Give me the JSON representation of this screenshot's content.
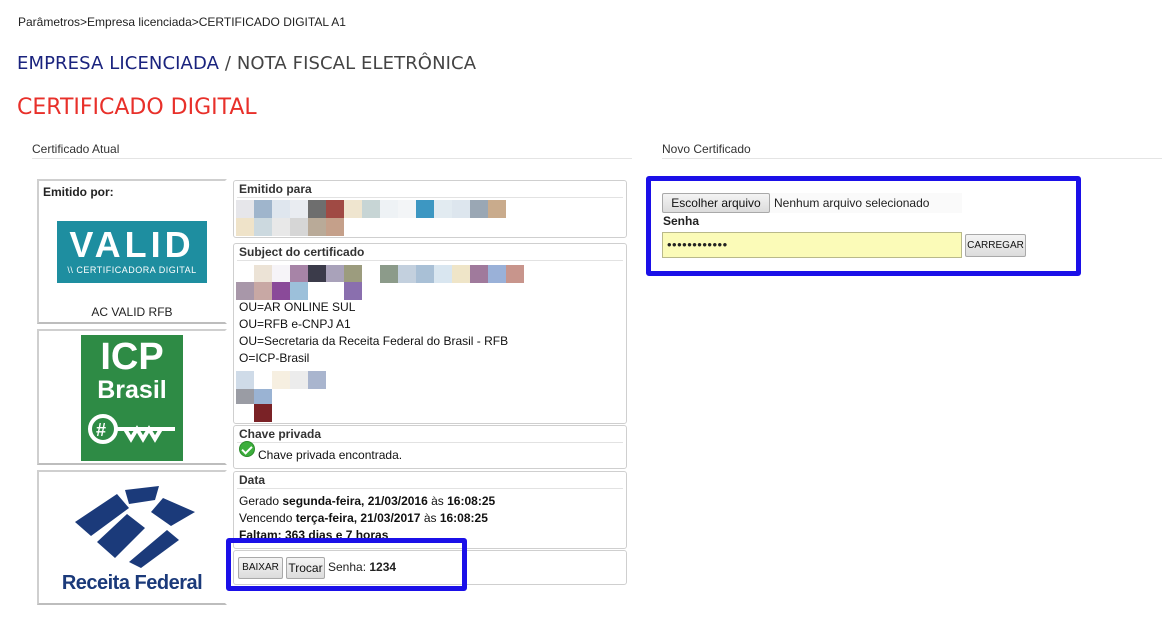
{
  "breadcrumb": "Parâmetros>Empresa licenciada>CERTIFICADO DIGITAL A1",
  "heading": {
    "part1": "EMPRESA LICENCIADA",
    "separator": " / ",
    "part2": "NOTA FISCAL ELETRÔNICA"
  },
  "page_title": "CERTIFICADO DIGITAL",
  "current_cert": {
    "section_label": "Certificado Atual",
    "issuer_label": "Emitido por:",
    "issuer_logo": {
      "main": "VALID",
      "sub": "\\\\ CERTIFICADORA DIGITAL"
    },
    "issuer_name": "AC VALID RFB",
    "icp_logo": {
      "line1": "ICP",
      "line2": "Brasil"
    },
    "rf_logo_text": "Receita Federal",
    "issued_to": {
      "title": "Emitido para"
    },
    "subject": {
      "title": "Subject do certificado",
      "lines": [
        "OU=AR ONLINE SUL",
        "OU=RFB e-CNPJ A1",
        "OU=Secretaria da Receita Federal do Brasil - RFB",
        "O=ICP-Brasil"
      ]
    },
    "private_key": {
      "title": "Chave privada",
      "status": "Chave privada encontrada."
    },
    "dates": {
      "title": "Data",
      "generated_prefix": "Gerado ",
      "generated_date": "segunda-feira, 21/03/2016",
      "generated_at": " às ",
      "generated_time": "16:08:25",
      "expires_prefix": "Vencendo ",
      "expires_date": "terça-feira, 21/03/2017",
      "expires_at": " às ",
      "expires_time": "16:08:25",
      "remaining": "Faltam: 363 dias e 7 horas"
    },
    "actions": {
      "download_label": "BAIXAR",
      "change_label": "Trocar",
      "password_label": "Senha: ",
      "password_value": "1234"
    }
  },
  "new_cert": {
    "section_label": "Novo Certificado",
    "choose_file_label": "Escolher arquivo",
    "no_file_text": "Nenhum arquivo selecionado",
    "password_label": "Senha",
    "password_value": "••••••••••••",
    "load_label": "CARREGAR"
  },
  "colors": {
    "title_red": "#e8302a",
    "heading_navy": "#1a237e",
    "highlight_blue": "#1b10e8",
    "password_bg": "#fbfbb8"
  },
  "mosaics": {
    "issued_to_row1": [
      "#e6e6ea",
      "#9fb5cc",
      "#dfe6ee",
      "#e9ecf1",
      "#6e6e6e",
      "#a04a44",
      "#efe5cf",
      "#c7d5d5",
      "#eef2f5",
      "#f3f5f7",
      "#3d97c2",
      "#e2ebf1",
      "#dde6ee",
      "#9aa7b4",
      "#c9ab8c"
    ],
    "issued_to_row2": [
      "#efe3c9",
      "#ccd9df",
      "#e8e8e8",
      "#d6d6d6",
      "#b9aa98",
      "#c5a08a"
    ],
    "subject_row1": [
      "#ffffff",
      "#ece3d6",
      "#f6f4f8",
      "#a784a7",
      "#3b3b4a",
      "#a9a2ba",
      "#9c9c7e",
      "#ffffff",
      "#8c9b8a",
      "#c3d0de",
      "#a9c0d6",
      "#d9e6f0",
      "#efe5c8",
      "#a07a9c",
      "#9ab1d8",
      "#c8958c"
    ],
    "subject_row2": [
      "#a897a9",
      "#c8a8a4",
      "#8a4a99",
      "#9cc0da",
      "#ffffff",
      "#ffffff",
      "#8a6fae"
    ],
    "subject_row3": [
      "#cfdbe8",
      "#ffffff",
      "#f6efe1",
      "#ececec",
      "#a9b5ce"
    ],
    "subject_row4": [
      "#9a9ca4",
      "#9ab3d3"
    ],
    "subject_row5": [
      "#ffffff",
      "#7a2226"
    ]
  }
}
